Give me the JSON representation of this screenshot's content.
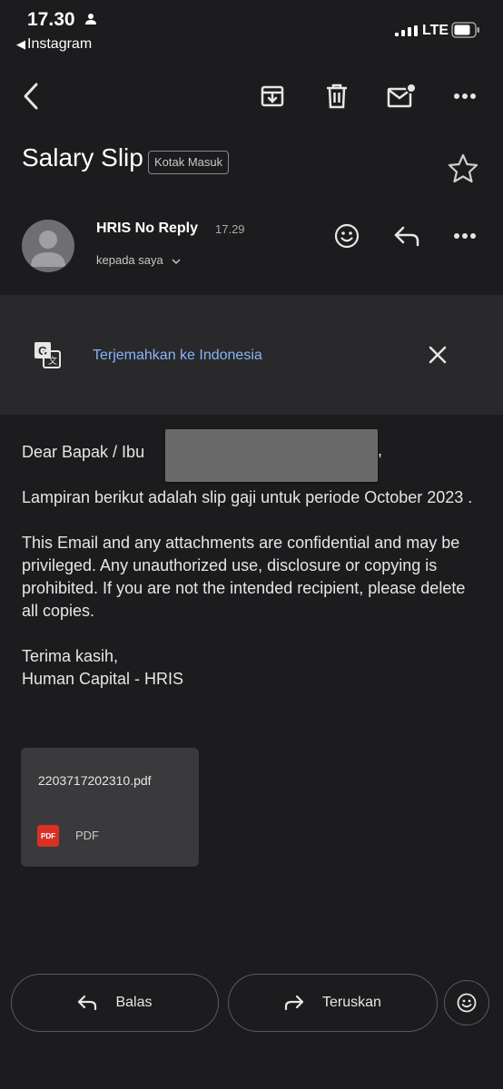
{
  "status_bar": {
    "time": "17.30",
    "back_app": "Instagram",
    "network": "LTE"
  },
  "toolbar": {
    "icons": [
      "back-arrow-icon",
      "archive-icon",
      "trash-icon",
      "mark-unread-icon",
      "more-icon"
    ]
  },
  "email": {
    "subject": "Salary Slip",
    "label": "Kotak Masuk",
    "sender": "HRIS No Reply",
    "time": "17.29",
    "recipient": "kepada saya"
  },
  "translate": {
    "text": "Terjemahkan ke Indonesia"
  },
  "body": {
    "greeting": "Dear Bapak / Ibu",
    "greeting_end": ",",
    "paragraph1": "Lampiran berikut adalah slip gaji untuk periode October 2023 .",
    "paragraph2": "This Email and any attachments are confidential and may be privileged. Any unauthorized use, disclosure or copying is prohibited. If you are not the intended recipient, please delete all copies.",
    "closing_line1": "Terima kasih,",
    "closing_line2": "Human Capital - HRIS"
  },
  "attachment": {
    "filename": "2203717202310.pdf",
    "badge": "PDF",
    "type": "PDF"
  },
  "actions": {
    "reply": "Balas",
    "forward": "Teruskan"
  },
  "colors": {
    "background": "#1c1c1e",
    "link": "#8ab4f8",
    "pdf_red": "#d93025"
  }
}
